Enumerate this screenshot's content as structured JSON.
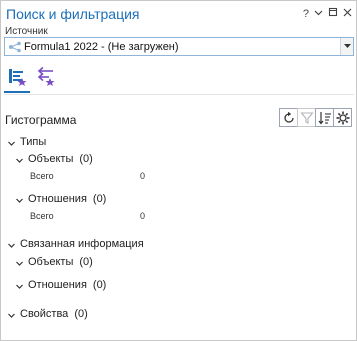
{
  "window": {
    "title": "Поиск и фильтрация",
    "help": "?",
    "menu": "⌄",
    "pin": "⊓",
    "close": "✕"
  },
  "source": {
    "label": "Источник",
    "value": "Formula1 2022 - (Не загружен)"
  },
  "histogram": {
    "title": "Гистограмма"
  },
  "tree": {
    "types": {
      "label": "Типы"
    },
    "types_objects": {
      "label": "Объекты",
      "count": "(0)",
      "total_label": "Всего",
      "total_value": "0"
    },
    "types_relations": {
      "label": "Отношения",
      "count": "(0)",
      "total_label": "Всего",
      "total_value": "0"
    },
    "related": {
      "label": "Связанная информация"
    },
    "related_objects": {
      "label": "Объекты",
      "count": "(0)"
    },
    "related_relations": {
      "label": "Отношения",
      "count": "(0)"
    },
    "properties": {
      "label": "Свойства",
      "count": "(0)"
    }
  },
  "colors": {
    "accent": "#1d6fb8",
    "purple": "#7a4fc6"
  }
}
